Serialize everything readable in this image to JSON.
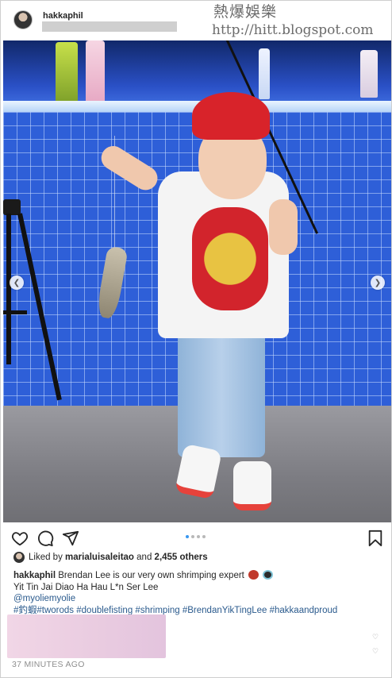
{
  "header": {
    "username": "hakkaphil"
  },
  "watermark": {
    "line1": "熱爆娛樂",
    "line2": "http://hitt.blogspot.com"
  },
  "carousel": {
    "slide_count": 4,
    "active_index": 0
  },
  "likes": {
    "prefix": "Liked by ",
    "user": "marialuisaleitao",
    "middle": " and ",
    "count_text": "2,455 others"
  },
  "caption": {
    "username": "hakkaphil",
    "line1": "Brendan Lee is our very own shrimping expert",
    "line2": "Yit Tin Jai Diao Ha Hau L*n Ser Lee",
    "mention": "@myoliemyolie",
    "hashtags": "#釣蝦#tworods #doublefisting #shrimping #BrendanYikTingLee #hakkaandproud"
  },
  "timestamp": "37 MINUTES AGO",
  "colors": {
    "link": "#2a5a8d",
    "dot_active": "#3897f0",
    "cap_red": "#d8232a",
    "tile_blue": "#2e5fd8"
  },
  "icons": {
    "like": "heart-icon",
    "comment": "comment-icon",
    "share": "share-icon",
    "save": "bookmark-icon",
    "prev": "chevron-left-icon",
    "next": "chevron-right-icon"
  }
}
